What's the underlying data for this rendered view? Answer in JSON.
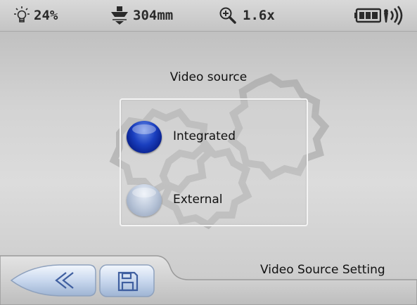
{
  "status_bar": {
    "brightness_value": "24%",
    "distance_value": "304mm",
    "zoom_value": "1.6x",
    "brightness_icon": "bulb-icon",
    "distance_icon": "probe-distance-icon",
    "zoom_icon": "zoom-in-icon",
    "battery_icon": "battery-icon",
    "signal_icon": "wireless-signal-icon"
  },
  "dialog": {
    "title": "Video source",
    "options": [
      {
        "label": "Integrated",
        "selected": true
      },
      {
        "label": "External",
        "selected": false
      }
    ]
  },
  "bottom_bar": {
    "back_icon": "double-chevron-left-icon",
    "save_icon": "floppy-disk-icon",
    "status_text": "Video Source Setting"
  },
  "colors": {
    "selected_radio": "#1a3fbf",
    "unselected_radio": "#b5c2d6",
    "background": "#d3d3d3"
  }
}
